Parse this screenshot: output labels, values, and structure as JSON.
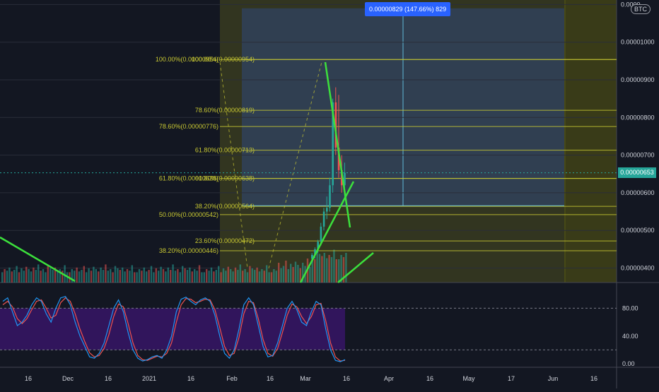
{
  "colors": {
    "background": "#131722",
    "up": "#26a69a",
    "down": "#ef5350",
    "fib": "#c8c832",
    "fib_text": "#c8c832",
    "trendline": "#3ce03c",
    "stoch_k": "#2196f3",
    "stoch_d": "#ef5350",
    "rsi_band": "#4a148c",
    "measure_box": "#2962ff",
    "zone_yellow": "#6e6e1e",
    "price_line": "#26a69a"
  },
  "header": {
    "currency": "BTC",
    "measure_label": "0.00000829 (147.66%) 829",
    "price_tag": "0.00000653"
  },
  "chart_data": [
    {
      "type": "candlestick",
      "title": "",
      "x_axis": {
        "labels": [
          "16",
          "Dec",
          "16",
          "2021",
          "16",
          "Feb",
          "16",
          "Mar",
          "16",
          "Apr",
          "16",
          "May",
          "17",
          "Jun",
          "16"
        ]
      },
      "y_axis": {
        "ylim": [
          3.5e-06,
          1.1e-05
        ],
        "tick_labels": [
          "0.00000400",
          "0.00000500",
          "0.00000600",
          "0.00000700",
          "0.00000800",
          "0.00000900",
          "0.00001000",
          "0.0000"
        ]
      },
      "last_price": 6.53e-06,
      "candles_recent": [
        {
          "o": 4.25e-06,
          "h": 4.4e-06,
          "l": 4.15e-06,
          "c": 4.35e-06
        },
        {
          "o": 4.35e-06,
          "h": 4.55e-06,
          "l": 4.25e-06,
          "c": 4.5e-06
        },
        {
          "o": 4.5e-06,
          "h": 4.75e-06,
          "l": 4.4e-06,
          "c": 4.7e-06
        },
        {
          "o": 4.7e-06,
          "h": 5.2e-06,
          "l": 4.6e-06,
          "c": 5.1e-06
        },
        {
          "o": 5.1e-06,
          "h": 5.6e-06,
          "l": 5e-06,
          "c": 5.5e-06
        },
        {
          "o": 5.5e-06,
          "h": 5.9e-06,
          "l": 5.3e-06,
          "c": 5.6e-06
        },
        {
          "o": 5.6e-06,
          "h": 6.4e-06,
          "l": 5.5e-06,
          "c": 6.2e-06
        },
        {
          "o": 6.2e-06,
          "h": 8.5e-06,
          "l": 6e-06,
          "c": 8.4e-06
        },
        {
          "o": 8.4e-06,
          "h": 8.8e-06,
          "l": 7e-06,
          "c": 7.2e-06
        },
        {
          "o": 7.2e-06,
          "h": 8.6e-06,
          "l": 6.4e-06,
          "c": 6.6e-06
        },
        {
          "o": 6.6e-06,
          "h": 7e-06,
          "l": 6e-06,
          "c": 6.2e-06
        },
        {
          "o": 6.2e-06,
          "h": 6.8e-06,
          "l": 5.9e-06,
          "c": 6.53e-06
        }
      ],
      "volume_pattern": [
        0.3,
        0.5,
        0.4,
        0.6,
        0.35,
        0.45,
        0.7,
        0.3,
        0.55,
        0.4,
        0.65,
        0.5,
        0.35,
        0.6,
        0.45,
        0.8,
        0.4,
        0.5,
        0.3,
        0.7,
        0.55,
        0.45,
        0.6,
        0.35,
        0.5,
        0.4,
        0.75,
        0.3
      ],
      "fib_levels": [
        {
          "label": "100.00%(0.00000954)",
          "value": 9.54e-06,
          "align": "left"
        },
        {
          "label": "100.00%(0.00000954)",
          "value": 9.54e-06,
          "align": "right"
        },
        {
          "label": "78.60%(0.00000819)",
          "value": 8.19e-06,
          "align": "right"
        },
        {
          "label": "78.60%(0.00000776)",
          "value": 7.76e-06,
          "align": "left"
        },
        {
          "label": "61.80%(0.00000713)",
          "value": 7.13e-06,
          "align": "right"
        },
        {
          "label": "61.80%(0.00000638)",
          "value": 6.38e-06,
          "align": "left"
        },
        {
          "label": "61.80%(0.00000638)",
          "value": 6.38e-06,
          "align": "right"
        },
        {
          "label": "38.20%(0.00000564)",
          "value": 5.64e-06,
          "align": "right"
        },
        {
          "label": "50.00%(0.00000542)",
          "value": 5.42e-06,
          "align": "left"
        },
        {
          "label": "23.60%(0.00000472)",
          "value": 4.72e-06,
          "align": "right"
        },
        {
          "label": "38.20%(0.00000446)",
          "value": 4.46e-06,
          "align": "left"
        }
      ],
      "measure": {
        "from": 5.65e-06,
        "to": 1.09e-05
      }
    },
    {
      "type": "line",
      "title": "",
      "ylim": [
        -5,
        115
      ],
      "tick_labels": [
        "80.00",
        "40.00",
        "0.00"
      ],
      "tick_values": [
        80,
        40,
        0
      ],
      "band": [
        20,
        80
      ],
      "k_values": [
        90,
        95,
        75,
        55,
        60,
        70,
        85,
        95,
        90,
        72,
        60,
        80,
        95,
        97,
        85,
        60,
        40,
        25,
        10,
        8,
        15,
        30,
        55,
        80,
        92,
        75,
        45,
        20,
        8,
        4,
        6,
        10,
        12,
        8,
        20,
        40,
        75,
        93,
        96,
        90,
        85,
        92,
        95,
        90,
        70,
        40,
        15,
        8,
        20,
        50,
        85,
        95,
        85,
        55,
        25,
        10,
        12,
        30,
        55,
        80,
        90,
        78,
        60,
        55,
        75,
        90,
        85,
        50,
        20,
        5,
        3,
        6
      ],
      "d_values": [
        85,
        90,
        82,
        65,
        58,
        65,
        78,
        90,
        92,
        80,
        66,
        70,
        88,
        95,
        90,
        72,
        50,
        32,
        16,
        10,
        12,
        22,
        42,
        68,
        86,
        82,
        58,
        30,
        12,
        6,
        5,
        8,
        11,
        10,
        15,
        30,
        60,
        85,
        94,
        93,
        88,
        90,
        93,
        92,
        78,
        52,
        25,
        12,
        15,
        38,
        72,
        90,
        88,
        65,
        35,
        15,
        11,
        22,
        45,
        70,
        86,
        82,
        68,
        58,
        68,
        85,
        87,
        62,
        30,
        10,
        4,
        5
      ]
    }
  ]
}
